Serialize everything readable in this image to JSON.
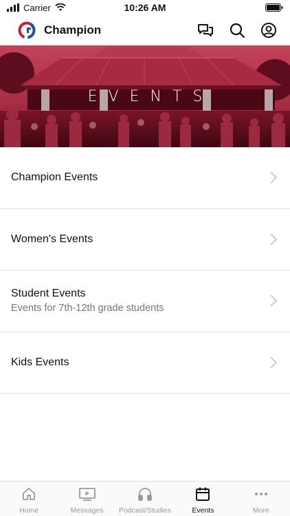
{
  "status": {
    "carrier": "Carrier",
    "time": "10:26 AM"
  },
  "header": {
    "title": "Champion",
    "icons": [
      "chat-icon",
      "search-icon",
      "account-icon"
    ]
  },
  "banner": {
    "title": "EVENTS"
  },
  "events": [
    {
      "title": "Champion Events",
      "subtitle": ""
    },
    {
      "title": "Women's Events",
      "subtitle": ""
    },
    {
      "title": "Student Events",
      "subtitle": "Events for 7th-12th grade students"
    },
    {
      "title": "Kids Events",
      "subtitle": ""
    }
  ],
  "tabs": [
    {
      "label": "Home",
      "icon": "home-icon"
    },
    {
      "label": "Messages",
      "icon": "video-icon"
    },
    {
      "label": "Podcast/Studies",
      "icon": "headphones-icon"
    },
    {
      "label": "Events",
      "icon": "calendar-icon",
      "active": true
    },
    {
      "label": "More",
      "icon": "more-icon"
    }
  ],
  "colors": {
    "brand_red": "#8b1a2e",
    "logo_blue": "#1f4e9c",
    "logo_red": "#c8202f",
    "inactive_tab": "#999999"
  }
}
